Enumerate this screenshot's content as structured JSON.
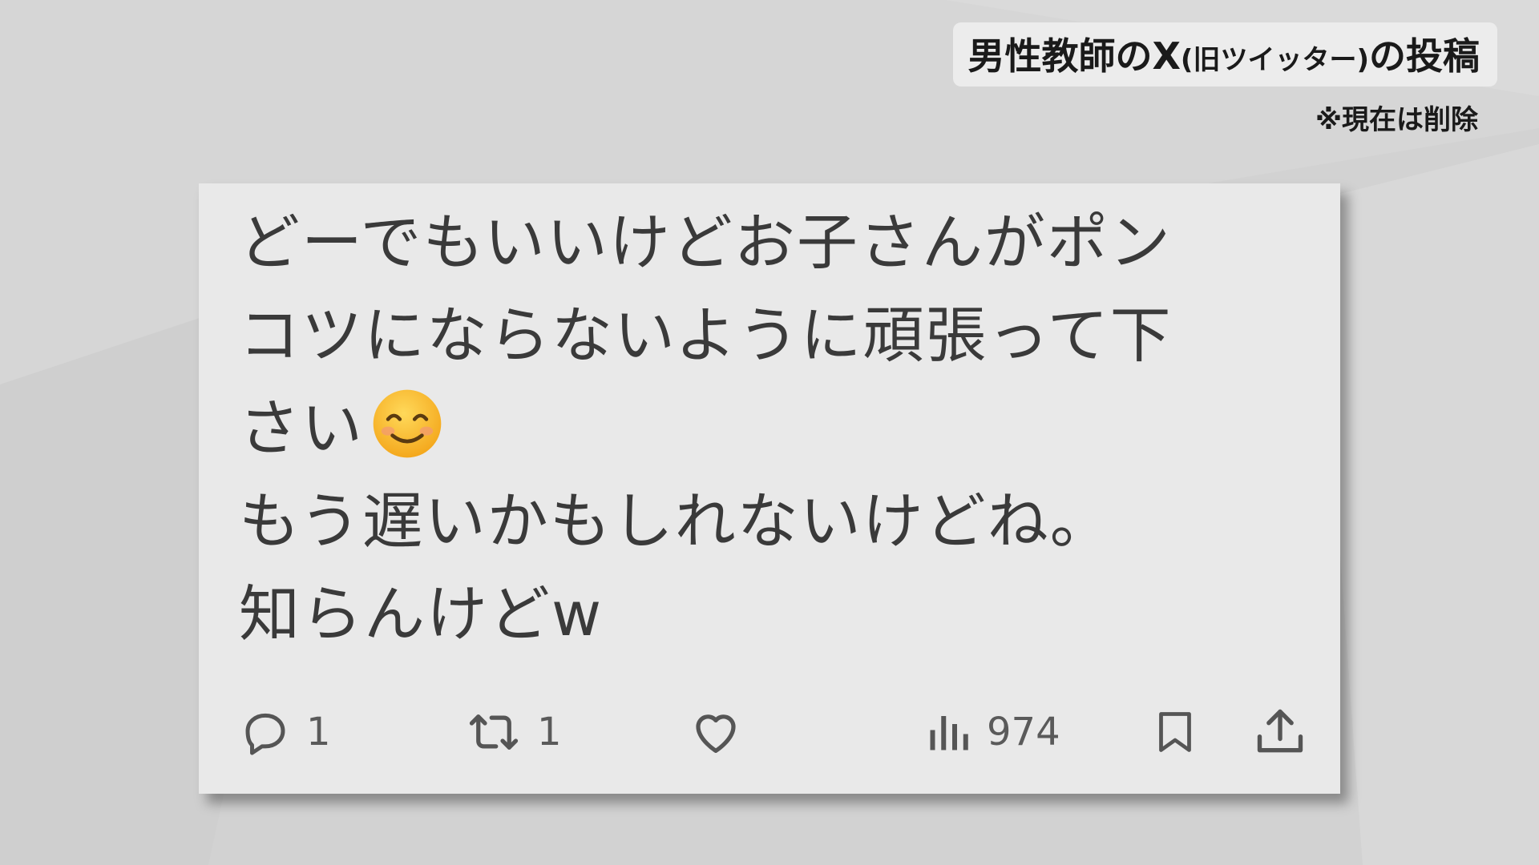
{
  "caption": {
    "title_main": "男性教師のX",
    "title_paren": "(旧ツイッター)",
    "title_end": "の投稿",
    "note": "※現在は削除"
  },
  "post": {
    "lines": [
      "どーでもいいけどお子さんがポン",
      "コツにならないように頑張って下",
      "さい",
      "もう遅いかもしれないけどね。",
      "知らんけどw"
    ],
    "emoji": "smiling-face-icon"
  },
  "actions": {
    "reply": {
      "icon": "reply-icon",
      "count": "1"
    },
    "repost": {
      "icon": "repost-icon",
      "count": "1"
    },
    "like": {
      "icon": "heart-icon",
      "count": ""
    },
    "views": {
      "icon": "views-icon",
      "count": "974"
    },
    "bookmark": {
      "icon": "bookmark-icon"
    },
    "share": {
      "icon": "share-icon"
    }
  },
  "colors": {
    "background": "#d2d2d2",
    "card": "#e9e9e9",
    "text": "#3a3a3a",
    "icon": "#555555"
  }
}
